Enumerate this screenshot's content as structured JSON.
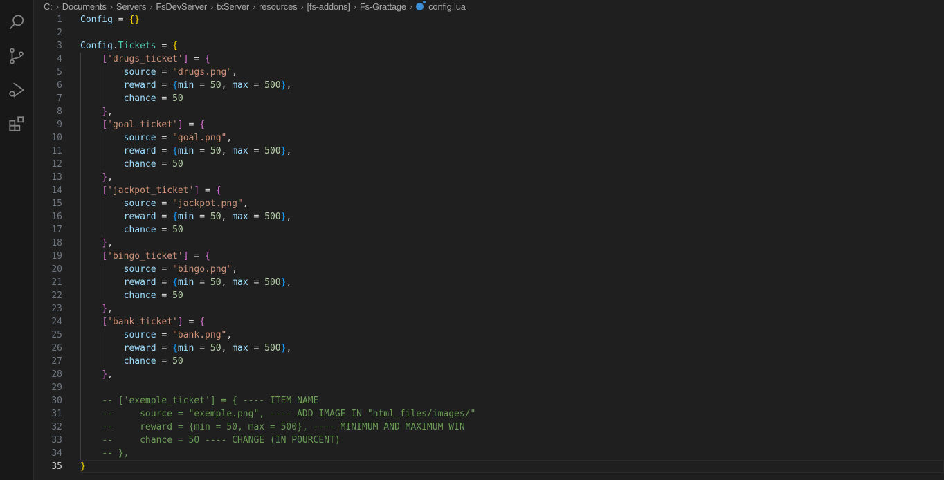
{
  "activity_bar": [
    {
      "name": "search-icon"
    },
    {
      "name": "source-control-icon"
    },
    {
      "name": "run-debug-icon"
    },
    {
      "name": "extensions-icon"
    }
  ],
  "breadcrumb": [
    "C:",
    "Documents",
    "Servers",
    "FsDevServer",
    "txServer",
    "resources",
    "[fs-addons]",
    "Fs-Grattage"
  ],
  "file_name": "config.lua",
  "current_line": 35,
  "lines": [
    [
      [
        "var",
        "Config"
      ],
      [
        "op",
        " = "
      ],
      [
        "b1",
        "{}"
      ]
    ],
    [],
    [
      [
        "var",
        "Config"
      ],
      [
        "op",
        "."
      ],
      [
        "field",
        "Tickets"
      ],
      [
        "op",
        " = "
      ],
      [
        "b1",
        "{"
      ]
    ],
    [
      [
        "op",
        "    "
      ],
      [
        "b2",
        "["
      ],
      [
        "str",
        "'drugs_ticket'"
      ],
      [
        "b2",
        "]"
      ],
      [
        "op",
        " = "
      ],
      [
        "b2",
        "{"
      ]
    ],
    [
      [
        "op",
        "        "
      ],
      [
        "var",
        "source"
      ],
      [
        "op",
        " = "
      ],
      [
        "str",
        "\"drugs.png\""
      ],
      [
        "op",
        ","
      ]
    ],
    [
      [
        "op",
        "        "
      ],
      [
        "var",
        "reward"
      ],
      [
        "op",
        " = "
      ],
      [
        "b3",
        "{"
      ],
      [
        "var",
        "min"
      ],
      [
        "op",
        " = "
      ],
      [
        "num",
        "50"
      ],
      [
        "op",
        ", "
      ],
      [
        "var",
        "max"
      ],
      [
        "op",
        " = "
      ],
      [
        "num",
        "500"
      ],
      [
        "b3",
        "}"
      ],
      [
        "op",
        ","
      ]
    ],
    [
      [
        "op",
        "        "
      ],
      [
        "var",
        "chance"
      ],
      [
        "op",
        " = "
      ],
      [
        "num",
        "50"
      ]
    ],
    [
      [
        "op",
        "    "
      ],
      [
        "b2",
        "}"
      ],
      [
        "op",
        ","
      ]
    ],
    [
      [
        "op",
        "    "
      ],
      [
        "b2",
        "["
      ],
      [
        "str",
        "'goal_ticket'"
      ],
      [
        "b2",
        "]"
      ],
      [
        "op",
        " = "
      ],
      [
        "b2",
        "{"
      ]
    ],
    [
      [
        "op",
        "        "
      ],
      [
        "var",
        "source"
      ],
      [
        "op",
        " = "
      ],
      [
        "str",
        "\"goal.png\""
      ],
      [
        "op",
        ","
      ]
    ],
    [
      [
        "op",
        "        "
      ],
      [
        "var",
        "reward"
      ],
      [
        "op",
        " = "
      ],
      [
        "b3",
        "{"
      ],
      [
        "var",
        "min"
      ],
      [
        "op",
        " = "
      ],
      [
        "num",
        "50"
      ],
      [
        "op",
        ", "
      ],
      [
        "var",
        "max"
      ],
      [
        "op",
        " = "
      ],
      [
        "num",
        "500"
      ],
      [
        "b3",
        "}"
      ],
      [
        "op",
        ","
      ]
    ],
    [
      [
        "op",
        "        "
      ],
      [
        "var",
        "chance"
      ],
      [
        "op",
        " = "
      ],
      [
        "num",
        "50"
      ]
    ],
    [
      [
        "op",
        "    "
      ],
      [
        "b2",
        "}"
      ],
      [
        "op",
        ","
      ]
    ],
    [
      [
        "op",
        "    "
      ],
      [
        "b2",
        "["
      ],
      [
        "str",
        "'jackpot_ticket'"
      ],
      [
        "b2",
        "]"
      ],
      [
        "op",
        " = "
      ],
      [
        "b2",
        "{"
      ]
    ],
    [
      [
        "op",
        "        "
      ],
      [
        "var",
        "source"
      ],
      [
        "op",
        " = "
      ],
      [
        "str",
        "\"jackpot.png\""
      ],
      [
        "op",
        ","
      ]
    ],
    [
      [
        "op",
        "        "
      ],
      [
        "var",
        "reward"
      ],
      [
        "op",
        " = "
      ],
      [
        "b3",
        "{"
      ],
      [
        "var",
        "min"
      ],
      [
        "op",
        " = "
      ],
      [
        "num",
        "50"
      ],
      [
        "op",
        ", "
      ],
      [
        "var",
        "max"
      ],
      [
        "op",
        " = "
      ],
      [
        "num",
        "500"
      ],
      [
        "b3",
        "}"
      ],
      [
        "op",
        ","
      ]
    ],
    [
      [
        "op",
        "        "
      ],
      [
        "var",
        "chance"
      ],
      [
        "op",
        " = "
      ],
      [
        "num",
        "50"
      ]
    ],
    [
      [
        "op",
        "    "
      ],
      [
        "b2",
        "}"
      ],
      [
        "op",
        ","
      ]
    ],
    [
      [
        "op",
        "    "
      ],
      [
        "b2",
        "["
      ],
      [
        "str",
        "'bingo_ticket'"
      ],
      [
        "b2",
        "]"
      ],
      [
        "op",
        " = "
      ],
      [
        "b2",
        "{"
      ]
    ],
    [
      [
        "op",
        "        "
      ],
      [
        "var",
        "source"
      ],
      [
        "op",
        " = "
      ],
      [
        "str",
        "\"bingo.png\""
      ],
      [
        "op",
        ","
      ]
    ],
    [
      [
        "op",
        "        "
      ],
      [
        "var",
        "reward"
      ],
      [
        "op",
        " = "
      ],
      [
        "b3",
        "{"
      ],
      [
        "var",
        "min"
      ],
      [
        "op",
        " = "
      ],
      [
        "num",
        "50"
      ],
      [
        "op",
        ", "
      ],
      [
        "var",
        "max"
      ],
      [
        "op",
        " = "
      ],
      [
        "num",
        "500"
      ],
      [
        "b3",
        "}"
      ],
      [
        "op",
        ","
      ]
    ],
    [
      [
        "op",
        "        "
      ],
      [
        "var",
        "chance"
      ],
      [
        "op",
        " = "
      ],
      [
        "num",
        "50"
      ]
    ],
    [
      [
        "op",
        "    "
      ],
      [
        "b2",
        "}"
      ],
      [
        "op",
        ","
      ]
    ],
    [
      [
        "op",
        "    "
      ],
      [
        "b2",
        "["
      ],
      [
        "str",
        "'bank_ticket'"
      ],
      [
        "b2",
        "]"
      ],
      [
        "op",
        " = "
      ],
      [
        "b2",
        "{"
      ]
    ],
    [
      [
        "op",
        "        "
      ],
      [
        "var",
        "source"
      ],
      [
        "op",
        " = "
      ],
      [
        "str",
        "\"bank.png\""
      ],
      [
        "op",
        ","
      ]
    ],
    [
      [
        "op",
        "        "
      ],
      [
        "var",
        "reward"
      ],
      [
        "op",
        " = "
      ],
      [
        "b3",
        "{"
      ],
      [
        "var",
        "min"
      ],
      [
        "op",
        " = "
      ],
      [
        "num",
        "50"
      ],
      [
        "op",
        ", "
      ],
      [
        "var",
        "max"
      ],
      [
        "op",
        " = "
      ],
      [
        "num",
        "500"
      ],
      [
        "b3",
        "}"
      ],
      [
        "op",
        ","
      ]
    ],
    [
      [
        "op",
        "        "
      ],
      [
        "var",
        "chance"
      ],
      [
        "op",
        " = "
      ],
      [
        "num",
        "50"
      ]
    ],
    [
      [
        "op",
        "    "
      ],
      [
        "b2",
        "}"
      ],
      [
        "op",
        ","
      ]
    ],
    [],
    [
      [
        "op",
        "    "
      ],
      [
        "com",
        "-- ['exemple_ticket'] = { ---- ITEM NAME"
      ]
    ],
    [
      [
        "op",
        "    "
      ],
      [
        "com",
        "--     source = \"exemple.png\", ---- ADD IMAGE IN \"html_files/images/\""
      ]
    ],
    [
      [
        "op",
        "    "
      ],
      [
        "com",
        "--     reward = {min = 50, max = 500}, ---- MINIMUM AND MAXIMUM WIN"
      ]
    ],
    [
      [
        "op",
        "    "
      ],
      [
        "com",
        "--     chance = 50 ---- CHANGE (IN POURCENT)"
      ]
    ],
    [
      [
        "op",
        "    "
      ],
      [
        "com",
        "-- },"
      ]
    ],
    [
      [
        "b1",
        "}"
      ]
    ]
  ]
}
